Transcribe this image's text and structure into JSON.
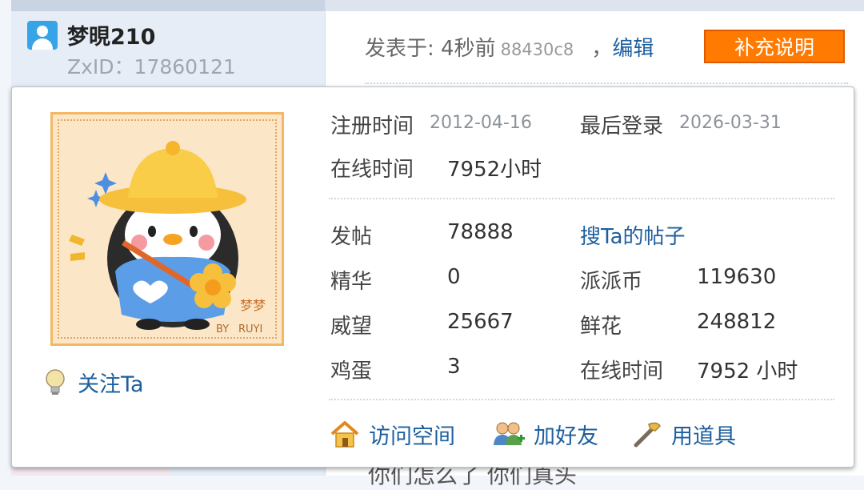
{
  "post": {
    "username": "梦晛210",
    "zxid": "ZxID：17860121",
    "posted_label": "发表于: 4秒前",
    "post_hash": "88430c8",
    "separator": "，",
    "edit_label": "编辑",
    "supplement_button": "补充说明",
    "partial_text": "你们怎么了 你们真头"
  },
  "card": {
    "register_label": "注册时间",
    "register_date": "2012-04-16",
    "last_login_label": "最后登录",
    "last_login_date": "2026-03-31",
    "online_label": "在线时间",
    "online_value": "7952小时",
    "stats": {
      "posts_label": "发帖",
      "posts_value": "78888",
      "search_posts_link": "搜Ta的帖子",
      "digest_label": "精华",
      "digest_value": "0",
      "coins_label": "派派币",
      "coins_value": "119630",
      "prestige_label": "威望",
      "prestige_value": "25667",
      "flowers_label": "鲜花",
      "flowers_value": "248812",
      "eggs_label": "鸡蛋",
      "eggs_value": "3",
      "online2_label": "在线时间",
      "online2_value": "7952 小时"
    },
    "follow_label": "关注Ta",
    "actions": {
      "visit_space": "访问空间",
      "add_friend": "加好友",
      "use_tool": "用道具"
    },
    "avatar_signature": "梦梦",
    "avatar_by": "BY",
    "avatar_ruyi": "RUYI"
  },
  "colors": {
    "link": "#1d5f9e",
    "button_orange": "#ff7a00",
    "avatar_border": "#f3b766"
  },
  "icons": {
    "user": "user-icon",
    "bulb": "bulb-icon",
    "home": "home-icon",
    "friends": "friends-icon",
    "tool": "tool-icon"
  }
}
